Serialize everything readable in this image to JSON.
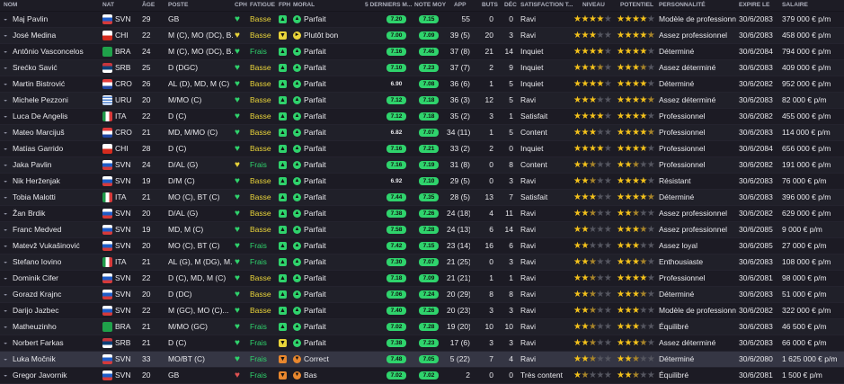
{
  "headers": [
    "NOM",
    "NAT",
    "ÂGE",
    "POSTE",
    "CPH",
    "FATIGUE",
    "FPH",
    "MORAL",
    "5 DERNIERS M...",
    "NOTE MOY",
    "APP",
    "BUTS",
    "DÉC",
    "SATISFACTION T...",
    "NIVEAU",
    "POTENTIEL",
    "PERSONNALITÉ",
    "EXPIRE LE",
    "SALAIRE"
  ],
  "colors": {
    "green": "#2fd36c",
    "yellow": "#e9d43a",
    "orange": "#e8872e",
    "red": "#e05252",
    "gold": "#f4c21b"
  },
  "rows": [
    {
      "name": "Maj Pavlin",
      "nat": "SVN",
      "age": "29",
      "pos": "GB",
      "cph": "green",
      "fatigue": "Basse",
      "fatigue_c": "yellow",
      "fph": "green",
      "moral": "Parfait",
      "moral_c": "green",
      "form": [
        "g",
        "g",
        "g",
        "g",
        "g"
      ],
      "n1": "7.20",
      "n1c": "green",
      "n2": "7.15",
      "n2c": "green",
      "app": "55",
      "buts": "0",
      "dec": "0",
      "sat": "Ravi",
      "niv": "4",
      "pot": "4",
      "pers": "Modèle de professionn...",
      "exp": "30/6/2083",
      "sal": "379 000 € p/m"
    },
    {
      "name": "José Medina",
      "nat": "CHI",
      "age": "22",
      "pos": "M (C), MO (DC), B...",
      "cph": "yellow",
      "fatigue": "Basse",
      "fatigue_c": "yellow",
      "fph": "yellow",
      "moral": "Plutôt bon",
      "moral_c": "yellow",
      "form": [
        "g",
        "g",
        "g",
        "g",
        "g"
      ],
      "n1": "7.00",
      "n1c": "green",
      "n2": "7.09",
      "n2c": "green",
      "app": "39 (5)",
      "buts": "20",
      "dec": "3",
      "sat": "Ravi",
      "niv": "3",
      "pot": "4.5",
      "pers": "Assez professionnel",
      "exp": "30/6/2083",
      "sal": "458 000 € p/m"
    },
    {
      "name": "Antônio Vasconcelos",
      "nat": "BRA",
      "age": "24",
      "pos": "M (C), MO (DC), B...",
      "cph": "green",
      "fatigue": "Frais",
      "fatigue_c": "green",
      "fph": "green",
      "moral": "Parfait",
      "moral_c": "green",
      "form": [
        "g",
        "g",
        "g",
        "g",
        "g"
      ],
      "n1": "7.16",
      "n1c": "green",
      "n2": "7.46",
      "n2c": "green",
      "app": "37 (8)",
      "buts": "21",
      "dec": "14",
      "sat": "Inquiet",
      "niv": "4",
      "pot": "4",
      "pers": "Déterminé",
      "exp": "30/6/2084",
      "sal": "794 000 € p/m"
    },
    {
      "name": "Srećko Savić",
      "nat": "SRB",
      "age": "25",
      "pos": "D (DGC)",
      "cph": "green",
      "fatigue": "Basse",
      "fatigue_c": "yellow",
      "fph": "green",
      "moral": "Parfait",
      "moral_c": "green",
      "form": [
        "g",
        "g",
        "g",
        "g",
        "g"
      ],
      "n1": "7.10",
      "n1c": "green",
      "n2": "7.23",
      "n2c": "green",
      "app": "37 (7)",
      "buts": "2",
      "dec": "9",
      "sat": "Inquiet",
      "niv": "3.5",
      "pot": "3.5",
      "pers": "Assez déterminé",
      "exp": "30/6/2083",
      "sal": "409 000 € p/m"
    },
    {
      "name": "Martin Bistrović",
      "nat": "CRO",
      "age": "26",
      "pos": "AL (D), MD, M (C)",
      "cph": "green",
      "fatigue": "Basse",
      "fatigue_c": "yellow",
      "fph": "green",
      "moral": "Parfait",
      "moral_c": "green",
      "form": [
        "g",
        "g",
        "g",
        "g",
        "g"
      ],
      "n1": "6.90",
      "n1c": "none",
      "n2": "7.08",
      "n2c": "green",
      "app": "36 (6)",
      "buts": "1",
      "dec": "5",
      "sat": "Inquiet",
      "niv": "4",
      "pot": "4",
      "pers": "Déterminé",
      "exp": "30/6/2082",
      "sal": "952 000 € p/m"
    },
    {
      "name": "Michele Pezzoni",
      "nat": "URU",
      "age": "20",
      "pos": "M/MO (C)",
      "cph": "green",
      "fatigue": "Basse",
      "fatigue_c": "yellow",
      "fph": "green",
      "moral": "Parfait",
      "moral_c": "green",
      "form": [
        "g",
        "g",
        "g",
        "g",
        "g"
      ],
      "n1": "7.12",
      "n1c": "green",
      "n2": "7.18",
      "n2c": "green",
      "app": "36 (3)",
      "buts": "12",
      "dec": "5",
      "sat": "Ravi",
      "niv": "3",
      "pot": "4.5",
      "pers": "Assez déterminé",
      "exp": "30/6/2083",
      "sal": "82 000 € p/m"
    },
    {
      "name": "Luca De Angelis",
      "nat": "ITA",
      "age": "22",
      "pos": "D (C)",
      "cph": "green",
      "fatigue": "Basse",
      "fatigue_c": "yellow",
      "fph": "green",
      "moral": "Parfait",
      "moral_c": "green",
      "form": [
        "g",
        "g",
        "g",
        "g",
        "g"
      ],
      "n1": "7.12",
      "n1c": "green",
      "n2": "7.18",
      "n2c": "green",
      "app": "35 (2)",
      "buts": "3",
      "dec": "1",
      "sat": "Satisfait",
      "niv": "4",
      "pot": "4",
      "pers": "Professionnel",
      "exp": "30/6/2082",
      "sal": "455 000 € p/m"
    },
    {
      "name": "Mateo Marcijuš",
      "nat": "CRO",
      "age": "21",
      "pos": "MD, M/MO (C)",
      "cph": "green",
      "fatigue": "Basse",
      "fatigue_c": "yellow",
      "fph": "green",
      "moral": "Parfait",
      "moral_c": "green",
      "form": [
        "g",
        "g",
        "g",
        "g",
        "g"
      ],
      "n1": "6.82",
      "n1c": "none",
      "n2": "7.07",
      "n2c": "green",
      "app": "34 (11)",
      "buts": "1",
      "dec": "5",
      "sat": "Content",
      "niv": "3",
      "pot": "4.5",
      "pers": "Professionnel",
      "exp": "30/6/2083",
      "sal": "114 000 € p/m"
    },
    {
      "name": "Matías Garrido",
      "nat": "CHI",
      "age": "28",
      "pos": "D (C)",
      "cph": "green",
      "fatigue": "Basse",
      "fatigue_c": "yellow",
      "fph": "green",
      "moral": "Parfait",
      "moral_c": "green",
      "form": [
        "g",
        "g",
        "g",
        "g",
        "g"
      ],
      "n1": "7.16",
      "n1c": "green",
      "n2": "7.21",
      "n2c": "green",
      "app": "33 (2)",
      "buts": "2",
      "dec": "0",
      "sat": "Inquiet",
      "niv": "4",
      "pot": "4",
      "pers": "Professionnel",
      "exp": "30/6/2084",
      "sal": "656 000 € p/m"
    },
    {
      "name": "Jaka Pavlin",
      "nat": "SVN",
      "age": "24",
      "pos": "D/AL (G)",
      "cph": "yellow",
      "fatigue": "Frais",
      "fatigue_c": "green",
      "fph": "green",
      "moral": "Parfait",
      "moral_c": "green",
      "form": [
        "g",
        "g",
        "g",
        "g",
        "g"
      ],
      "n1": "7.16",
      "n1c": "green",
      "n2": "7.19",
      "n2c": "green",
      "app": "31 (8)",
      "buts": "0",
      "dec": "8",
      "sat": "Content",
      "niv": "2.5",
      "pot": "2.5",
      "pers": "Professionnel",
      "exp": "30/6/2082",
      "sal": "191 000 € p/m"
    },
    {
      "name": "Nik Herženjak",
      "nat": "SVN",
      "age": "19",
      "pos": "D/M (C)",
      "cph": "green",
      "fatigue": "Basse",
      "fatigue_c": "yellow",
      "fph": "green",
      "moral": "Parfait",
      "moral_c": "green",
      "form": [
        "g",
        "g",
        "g",
        "g",
        "g"
      ],
      "n1": "6.92",
      "n1c": "none",
      "n2": "7.10",
      "n2c": "green",
      "app": "29 (5)",
      "buts": "0",
      "dec": "3",
      "sat": "Ravi",
      "niv": "2.5",
      "pot": "4",
      "pers": "Résistant",
      "exp": "30/6/2083",
      "sal": "76 000 € p/m"
    },
    {
      "name": "Tobia Malotti",
      "nat": "ITA",
      "age": "21",
      "pos": "MO (C), BT (C)",
      "cph": "green",
      "fatigue": "Basse",
      "fatigue_c": "yellow",
      "fph": "green",
      "moral": "Parfait",
      "moral_c": "green",
      "form": [
        "g",
        "g",
        "g",
        "g",
        "g"
      ],
      "n1": "7.44",
      "n1c": "green",
      "n2": "7.35",
      "n2c": "green",
      "app": "28 (5)",
      "buts": "13",
      "dec": "7",
      "sat": "Satisfait",
      "niv": "3",
      "pot": "4.5",
      "pers": "Déterminé",
      "exp": "30/6/2083",
      "sal": "396 000 € p/m"
    },
    {
      "name": "Žan Brdik",
      "nat": "SVN",
      "age": "20",
      "pos": "D/AL (G)",
      "cph": "green",
      "fatigue": "Basse",
      "fatigue_c": "yellow",
      "fph": "green",
      "moral": "Parfait",
      "moral_c": "green",
      "form": [
        "g",
        "g",
        "g",
        "g",
        "g"
      ],
      "n1": "7.38",
      "n1c": "green",
      "n2": "7.26",
      "n2c": "green",
      "app": "24 (18)",
      "buts": "4",
      "dec": "11",
      "sat": "Ravi",
      "niv": "2.5",
      "pot": "2.5",
      "pers": "Assez professionnel",
      "exp": "30/6/2082",
      "sal": "629 000 € p/m"
    },
    {
      "name": "Franc Medved",
      "nat": "SVN",
      "age": "19",
      "pos": "MD, M (C)",
      "cph": "green",
      "fatigue": "Basse",
      "fatigue_c": "yellow",
      "fph": "green",
      "moral": "Parfait",
      "moral_c": "green",
      "form": [
        "g",
        "g",
        "g",
        "g",
        "g"
      ],
      "n1": "7.58",
      "n1c": "green",
      "n2": "7.28",
      "n2c": "green",
      "app": "24 (13)",
      "buts": "6",
      "dec": "14",
      "sat": "Ravi",
      "niv": "2",
      "pot": "3.5",
      "pers": "Assez professionnel",
      "exp": "30/6/2085",
      "sal": "9 000 € p/m"
    },
    {
      "name": "Matevž Vukašinović",
      "nat": "SVN",
      "age": "20",
      "pos": "MO (C), BT (C)",
      "cph": "green",
      "fatigue": "Frais",
      "fatigue_c": "green",
      "fph": "green",
      "moral": "Parfait",
      "moral_c": "green",
      "form": [
        "g",
        "g",
        "g",
        "g",
        "g"
      ],
      "n1": "7.42",
      "n1c": "green",
      "n2": "7.15",
      "n2c": "green",
      "app": "23 (14)",
      "buts": "16",
      "dec": "6",
      "sat": "Ravi",
      "niv": "2",
      "pot": "3",
      "pers": "Assez loyal",
      "exp": "30/6/2085",
      "sal": "27 000 € p/m"
    },
    {
      "name": "Stefano Iovino",
      "nat": "ITA",
      "age": "21",
      "pos": "AL (G), M (DG), M...",
      "cph": "green",
      "fatigue": "Frais",
      "fatigue_c": "green",
      "fph": "green",
      "moral": "Parfait",
      "moral_c": "green",
      "form": [
        "g",
        "g",
        "g",
        "g",
        "g"
      ],
      "n1": "7.30",
      "n1c": "green",
      "n2": "7.07",
      "n2c": "green",
      "app": "21 (25)",
      "buts": "0",
      "dec": "3",
      "sat": "Ravi",
      "niv": "2.5",
      "pot": "3.5",
      "pers": "Enthousiaste",
      "exp": "30/6/2083",
      "sal": "108 000 € p/m"
    },
    {
      "name": "Dominik Cifer",
      "nat": "SVN",
      "age": "22",
      "pos": "D (C), MD, M (C)",
      "cph": "green",
      "fatigue": "Basse",
      "fatigue_c": "yellow",
      "fph": "green",
      "moral": "Parfait",
      "moral_c": "green",
      "form": [
        "g",
        "g",
        "g",
        "g",
        "g"
      ],
      "n1": "7.18",
      "n1c": "green",
      "n2": "7.09",
      "n2c": "green",
      "app": "21 (21)",
      "buts": "1",
      "dec": "1",
      "sat": "Ravi",
      "niv": "2.5",
      "pot": "4",
      "pers": "Professionnel",
      "exp": "30/6/2081",
      "sal": "98 000 € p/m"
    },
    {
      "name": "Gorazd Krajnc",
      "nat": "SVN",
      "age": "20",
      "pos": "D (DC)",
      "cph": "green",
      "fatigue": "Basse",
      "fatigue_c": "yellow",
      "fph": "green",
      "moral": "Parfait",
      "moral_c": "green",
      "form": [
        "g",
        "g",
        "g",
        "g",
        "g"
      ],
      "n1": "7.06",
      "n1c": "green",
      "n2": "7.24",
      "n2c": "green",
      "app": "20 (29)",
      "buts": "8",
      "dec": "8",
      "sat": "Ravi",
      "niv": "2.5",
      "pot": "3.5",
      "pers": "Déterminé",
      "exp": "30/6/2083",
      "sal": "51 000 € p/m"
    },
    {
      "name": "Darijo Jazbec",
      "nat": "SVN",
      "age": "22",
      "pos": "M (GC), MO (C)...",
      "cph": "green",
      "fatigue": "Basse",
      "fatigue_c": "yellow",
      "fph": "green",
      "moral": "Parfait",
      "moral_c": "green",
      "form": [
        "g",
        "g",
        "g",
        "g",
        "g"
      ],
      "n1": "7.40",
      "n1c": "green",
      "n2": "7.26",
      "n2c": "green",
      "app": "20 (23)",
      "buts": "3",
      "dec": "3",
      "sat": "Ravi",
      "niv": "2.5",
      "pot": "3",
      "pers": "Modèle de professionn...",
      "exp": "30/6/2082",
      "sal": "322 000 € p/m"
    },
    {
      "name": "Matheuzinho",
      "nat": "BRA",
      "age": "21",
      "pos": "M/MO (GC)",
      "cph": "green",
      "fatigue": "Frais",
      "fatigue_c": "green",
      "fph": "green",
      "moral": "Parfait",
      "moral_c": "green",
      "form": [
        "g",
        "g",
        "g",
        "g",
        "g"
      ],
      "n1": "7.02",
      "n1c": "green",
      "n2": "7.28",
      "n2c": "green",
      "app": "19 (20)",
      "buts": "10",
      "dec": "10",
      "sat": "Ravi",
      "niv": "2.5",
      "pot": "3",
      "pers": "Équilibré",
      "exp": "30/6/2083",
      "sal": "46 500 € p/m"
    },
    {
      "name": "Norbert Farkas",
      "nat": "SRB",
      "age": "21",
      "pos": "D (C)",
      "cph": "green",
      "fatigue": "Frais",
      "fatigue_c": "green",
      "fph": "yellow",
      "moral": "Parfait",
      "moral_c": "green",
      "form": [
        "g",
        "g",
        "g",
        "g",
        "g"
      ],
      "n1": "7.38",
      "n1c": "green",
      "n2": "7.23",
      "n2c": "green",
      "app": "17 (6)",
      "buts": "3",
      "dec": "3",
      "sat": "Ravi",
      "niv": "2.5",
      "pot": "3.5",
      "pers": "Assez déterminé",
      "exp": "30/6/2083",
      "sal": "66 000 € p/m"
    },
    {
      "name": "Luka Močnik",
      "nat": "SVN",
      "age": "33",
      "pos": "MO/BT (C)",
      "cph": "green",
      "fatigue": "Frais",
      "fatigue_c": "green",
      "fph": "orange",
      "moral": "Correct",
      "moral_c": "orange",
      "form": [
        "g",
        "g",
        "g",
        "g",
        "g"
      ],
      "n1": "7.48",
      "n1c": "green",
      "n2": "7.05",
      "n2c": "green",
      "app": "5 (22)",
      "buts": "7",
      "dec": "4",
      "sat": "Ravi",
      "niv": "2.5",
      "pot": "2.5",
      "pers": "Déterminé",
      "exp": "30/6/2080",
      "sal": "1 625 000 € p/m"
    },
    {
      "name": "Gregor Javornik",
      "nat": "SVN",
      "age": "20",
      "pos": "GB",
      "cph": "red",
      "fatigue": "Frais",
      "fatigue_c": "green",
      "fph": "orange",
      "moral": "Bas",
      "moral_c": "orange",
      "form": [
        "g",
        "g",
        "g",
        "g",
        "g"
      ],
      "n1": "7.02",
      "n1c": "green",
      "n2": "7.02",
      "n2c": "green",
      "app": "2",
      "buts": "0",
      "dec": "0",
      "sat": "Très content",
      "niv": "1.5",
      "pot": "2.5",
      "pers": "Équilibré",
      "exp": "30/6/2081",
      "sal": "1 500 € p/m"
    }
  ]
}
